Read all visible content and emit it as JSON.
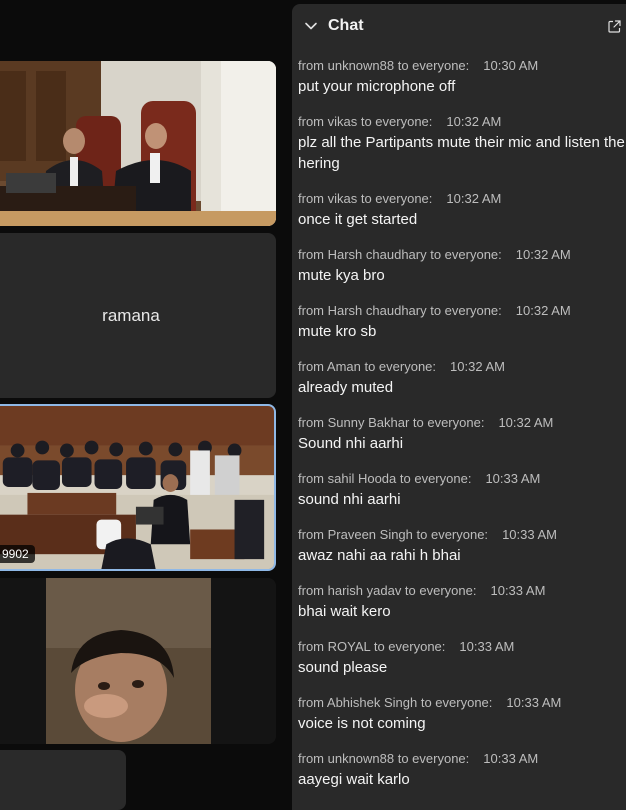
{
  "participants": [
    {
      "label": ""
    },
    {
      "label": "ramana"
    },
    {
      "label": "9902"
    },
    {
      "label": ""
    }
  ],
  "chat": {
    "title": "Chat",
    "messages": [
      {
        "sender": "from unknown88 to everyone:",
        "time": "10:30 AM",
        "text": "put your microphone off"
      },
      {
        "sender": "from vikas to everyone:",
        "time": "10:32 AM",
        "text": "plz all the Partipants mute their mic and listen the hering"
      },
      {
        "sender": "from vikas to everyone:",
        "time": "10:32 AM",
        "text": "once it get started"
      },
      {
        "sender": "from Harsh chaudhary to everyone:",
        "time": "10:32 AM",
        "text": "mute kya  bro"
      },
      {
        "sender": "from Harsh chaudhary to everyone:",
        "time": "10:32 AM",
        "text": "mute kro sb"
      },
      {
        "sender": "from Aman to everyone:",
        "time": "10:32 AM",
        "text": "already muted"
      },
      {
        "sender": "from Sunny Bakhar to everyone:",
        "time": "10:32 AM",
        "text": "Sound nhi aarhi"
      },
      {
        "sender": "from sahil Hooda to everyone:",
        "time": "10:33 AM",
        "text": "sound nhi aarhi"
      },
      {
        "sender": "from Praveen Singh to everyone:",
        "time": "10:33 AM",
        "text": "awaz nahi aa rahi h bhai"
      },
      {
        "sender": "from harish yadav to everyone:",
        "time": "10:33 AM",
        "text": "bhai wait kero"
      },
      {
        "sender": "from ROYAL to everyone:",
        "time": "10:33 AM",
        "text": "sound please"
      },
      {
        "sender": "from Abhishek Singh to everyone:",
        "time": "10:33 AM",
        "text": "voice is not coming"
      },
      {
        "sender": "from unknown88 to everyone:",
        "time": "10:33 AM",
        "text": "aayegi wait karlo"
      }
    ]
  },
  "icons": {
    "collapse": "chevron-down-icon",
    "popout": "popout-icon"
  },
  "colors": {
    "app_background": "#0b0b0b",
    "chat_background": "#292929",
    "active_speaker_border": "#8fb8e6"
  }
}
